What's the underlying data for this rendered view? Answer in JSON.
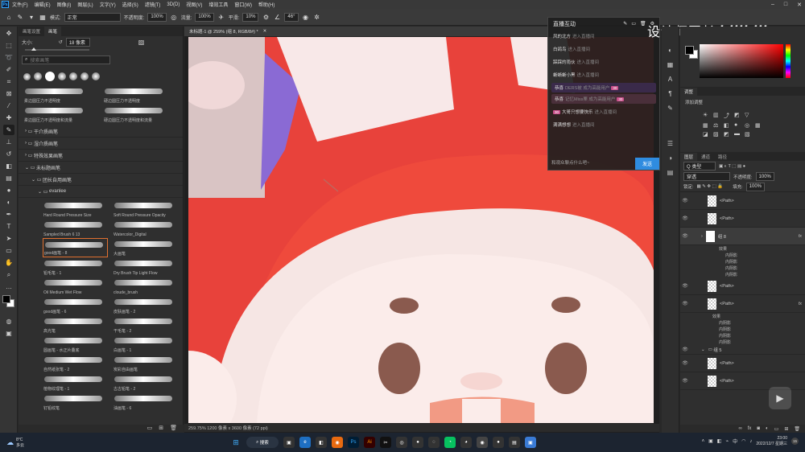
{
  "menubar": {
    "app_icon": "Ps",
    "items": [
      "文件(F)",
      "编辑(E)",
      "图像(I)",
      "图层(L)",
      "文字(Y)",
      "选择(S)",
      "滤镜(T)",
      "3D(D)",
      "视图(V)",
      "增效工具",
      "窗口(W)",
      "帮助(H)"
    ]
  },
  "options": {
    "mode_label": "模式:",
    "mode_value": "正常",
    "opacity_label": "不透明度:",
    "opacity_value": "100%",
    "flow_label": "流量:",
    "flow_value": "100%",
    "smooth_label": "平滑:",
    "smooth_value": "10%",
    "angle_value": "46°"
  },
  "brush_panel": {
    "tabs": [
      "画笔设置",
      "画笔"
    ],
    "size_label": "大小:",
    "size_value": "18 像素",
    "search_placeholder": "搜索画笔",
    "top_labels": [
      "柔边圆压力不透明度",
      "硬边圆压力不透明度",
      "柔边圆压力不透明度和流量",
      "硬边圆压力不透明度和流量"
    ],
    "folders": [
      "干介质画笔",
      "湿介质画笔",
      "特殊效果画笔",
      "未标题画笔",
      "团长自用画笔",
      "evanlee"
    ],
    "brushes": [
      "Hard Round Pressure Size",
      "Soft Round Pressure Opacity",
      "Sampled Brush 6 13",
      "Watercolor_Digital",
      "good画笔 - 8",
      "大画笔",
      "铅毛笔 - 1",
      "Dry Brush Tip Light Flow",
      "Oil Medium Wet Flow",
      "cloude_brush",
      "good画笔 - 6",
      "皮肤画笔 - 2",
      "高光笔",
      "干毛笔 - 2",
      "圆画笔 - 水正片叠底",
      "白画笔 - 1",
      "自然纸张笔 - 2",
      "炭彩自由画笔",
      "植物纹理笔 - 1",
      "古古铅笔 - 2",
      "钉铅纹笔",
      "油画笔 - 6"
    ],
    "selected_brush_index": 4
  },
  "document": {
    "tab_title": "未标题-1 @ 259% (组 8, RGB/8#) *",
    "status": "259.75%   1200 像素 x 3600 像素 (72 ppi)"
  },
  "chat": {
    "title": "直播互动",
    "messages": [
      {
        "name": "风的北方",
        "text": "进入直播间"
      },
      {
        "name": "白鸽鸟",
        "text": "进入直播间"
      },
      {
        "name": "踩踩的雨伙",
        "text": "进入直播间"
      },
      {
        "name": "蜥蜥蜥小黑",
        "text": "进入直播间"
      },
      {
        "name": "恭喜",
        "text": "DERS被 成为高能用户",
        "badge": "30"
      },
      {
        "name": "恭喜",
        "text": "记忆Miss栗 成为高能用户",
        "badge": "30"
      },
      {
        "name": "大哥只想要快乐",
        "text": "进入直播间",
        "badge": "30"
      },
      {
        "name": "满满想想",
        "text": "进入直播间"
      }
    ],
    "input_placeholder": "和观众聊点什么吧~",
    "send_label": "发送"
  },
  "brand": {
    "text": "设计师团长",
    "logo": "bilibili"
  },
  "right_panel": {
    "adjust_tab": "调整",
    "adjust_sub": "添加调整",
    "layer_tabs": [
      "图层",
      "通道",
      "路径"
    ],
    "kind_label": "Q 类型",
    "blend_value": "穿透",
    "opacity_label": "不透明度:",
    "opacity_value": "100%",
    "lock_label": "锁定:",
    "fill_label": "填充:",
    "fill_value": "100%",
    "layers": [
      "<Path>",
      "<Path>",
      "组 8",
      "<Path>",
      "<Path>",
      "组 5",
      "<Path>",
      "<Path>"
    ],
    "effects_label": "效果",
    "effects": [
      "内阴影",
      "内阴影",
      "内阴影",
      "内阴影"
    ]
  },
  "taskbar": {
    "weather_temp": "8°C",
    "weather_desc": "多云",
    "search": "搜索",
    "time": "23:00",
    "date": "2022/12/7 星期三",
    "notif": "15"
  }
}
